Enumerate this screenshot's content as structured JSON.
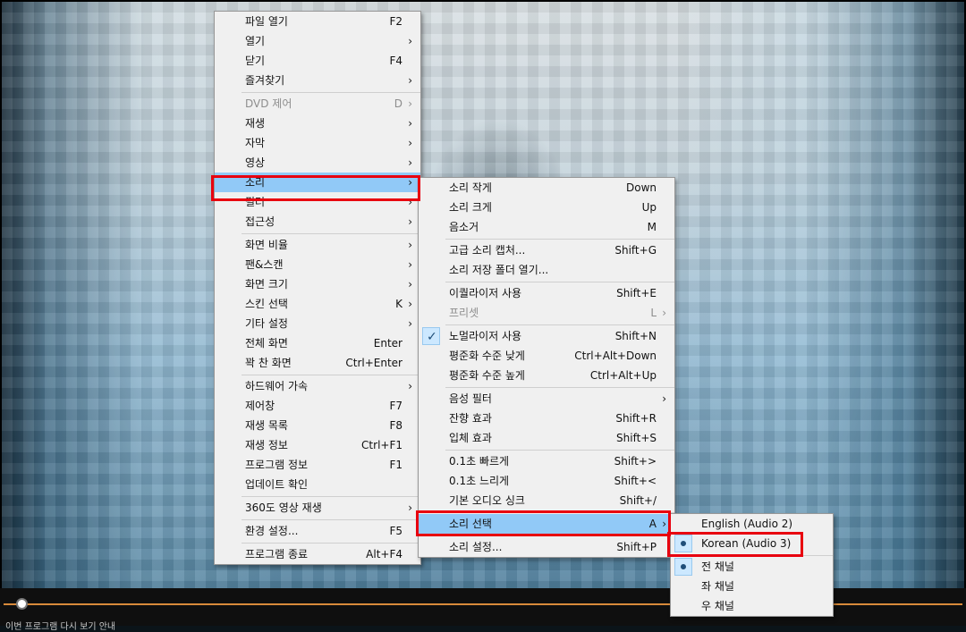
{
  "status_text": "이번 프로그램 다시 보기 안내",
  "main_menu": {
    "groups": [
      [
        {
          "label": "파일 열기",
          "shortcut": "F2"
        },
        {
          "label": "열기",
          "submenu": true
        },
        {
          "label": "닫기",
          "shortcut": "F4"
        },
        {
          "label": "즐겨찾기",
          "submenu": true
        }
      ],
      [
        {
          "label": "DVD 제어",
          "shortcut": "D",
          "submenu": true,
          "disabled": true
        },
        {
          "label": "재생",
          "submenu": true
        },
        {
          "label": "자막",
          "submenu": true
        },
        {
          "label": "영상",
          "submenu": true
        },
        {
          "label": "소리",
          "submenu": true,
          "highlighted": true
        },
        {
          "label": "필터",
          "submenu": true
        },
        {
          "label": "접근성",
          "submenu": true
        }
      ],
      [
        {
          "label": "화면 비율",
          "submenu": true
        },
        {
          "label": "팬&스캔",
          "submenu": true
        },
        {
          "label": "화면 크기",
          "submenu": true
        },
        {
          "label": "스킨 선택",
          "shortcut": "K",
          "submenu": true
        },
        {
          "label": "기타 설정",
          "submenu": true
        },
        {
          "label": "전체 화면",
          "shortcut": "Enter"
        },
        {
          "label": "꽉 찬 화면",
          "shortcut": "Ctrl+Enter"
        }
      ],
      [
        {
          "label": "하드웨어 가속",
          "submenu": true
        },
        {
          "label": "제어창",
          "shortcut": "F7"
        },
        {
          "label": "재생 목록",
          "shortcut": "F8"
        },
        {
          "label": "재생 정보",
          "shortcut": "Ctrl+F1"
        },
        {
          "label": "프로그램 정보",
          "shortcut": "F1"
        },
        {
          "label": "업데이트 확인"
        }
      ],
      [
        {
          "label": "360도 영상 재생",
          "submenu": true
        }
      ],
      [
        {
          "label": "환경 설정...",
          "shortcut": "F5"
        }
      ],
      [
        {
          "label": "프로그램 종료",
          "shortcut": "Alt+F4"
        }
      ]
    ]
  },
  "sound_menu": {
    "groups": [
      [
        {
          "label": "소리 작게",
          "shortcut": "Down"
        },
        {
          "label": "소리 크게",
          "shortcut": "Up"
        },
        {
          "label": "음소거",
          "shortcut": "M"
        }
      ],
      [
        {
          "label": "고급 소리 캡처...",
          "shortcut": "Shift+G"
        },
        {
          "label": "소리 저장 폴더 열기..."
        }
      ],
      [
        {
          "label": "이퀄라이저 사용",
          "shortcut": "Shift+E"
        },
        {
          "label": "프리셋",
          "shortcut": "L",
          "submenu": true,
          "disabled": true
        }
      ],
      [
        {
          "label": "노멀라이저 사용",
          "shortcut": "Shift+N",
          "checked": "tick"
        },
        {
          "label": "평준화 수준 낮게",
          "shortcut": "Ctrl+Alt+Down"
        },
        {
          "label": "평준화 수준 높게",
          "shortcut": "Ctrl+Alt+Up"
        }
      ],
      [
        {
          "label": "음성 필터",
          "submenu": true
        },
        {
          "label": "잔향 효과",
          "shortcut": "Shift+R"
        },
        {
          "label": "입체 효과",
          "shortcut": "Shift+S"
        }
      ],
      [
        {
          "label": "0.1초 빠르게",
          "shortcut": "Shift+>"
        },
        {
          "label": "0.1초 느리게",
          "shortcut": "Shift+<"
        },
        {
          "label": "기본 오디오 싱크",
          "shortcut": "Shift+/"
        }
      ],
      [
        {
          "label": "소리 선택",
          "shortcut": "A",
          "submenu": true,
          "highlighted": true
        }
      ],
      [
        {
          "label": "소리 설정...",
          "shortcut": "Shift+P"
        }
      ]
    ]
  },
  "audio_select_menu": {
    "groups": [
      [
        {
          "label": "English (Audio 2)"
        },
        {
          "label": "Korean (Audio 3)",
          "checked": "dot"
        }
      ],
      [
        {
          "label": "전 채널",
          "checked": "dot"
        },
        {
          "label": "좌 채널"
        },
        {
          "label": "우 채널"
        }
      ]
    ]
  },
  "annotation_color": "#e8000f",
  "highlight_color": "#91c9f7"
}
